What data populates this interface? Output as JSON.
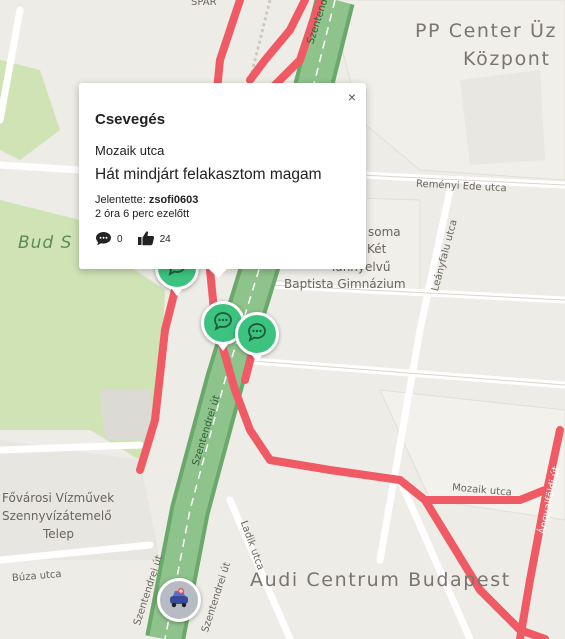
{
  "map": {
    "labels": {
      "spar": "SPAR",
      "pp_center": "PP Center Üz",
      "kozpont": "Központ",
      "remenyi": "Reményi Ede utca",
      "leanyfalu": "Leányfalu utca",
      "school_1": "soma",
      "school_2": "Két",
      "school_3": "Tannyelvű",
      "school_4": "Baptista Gimnázium",
      "bud": "Bud S",
      "vizmuvek_1": "Fővárosi Vízművek",
      "vizmuvek_2": "Szennyvízátemelő",
      "vizmuvek_3": "Telep",
      "buza": "Búza utca",
      "szentendrei_1": "Szentendrei út",
      "szentendrei_2": "Szentendrei út",
      "szentendrei_3": "Szentendrei út",
      "szentendrei_top": "Szentendrei",
      "ladik": "Ladik utca",
      "mozaik": "Mozaik utca",
      "audi": "Audi Centrum Budapest",
      "vertical_right": "Ángyalföldi út"
    },
    "colors": {
      "base": "#eeece6",
      "park": "#cfe3b4",
      "traffic": "#ef5a64",
      "highway": "#7ab47a",
      "marker": "#3cc37f"
    }
  },
  "popup": {
    "title": "Csevegés",
    "close": "×",
    "street": "Mozaik utca",
    "message": "Hát mindjárt felakasztom magam",
    "reported_label": "Jelentette:",
    "reporter": "zsofi0603",
    "time_ago": "2 óra 6 perc ezelőtt",
    "comments_count": "0",
    "likes_count": "24"
  },
  "markers": [
    {
      "icon": "chat-bubble-icon"
    },
    {
      "icon": "chat-bubble-icon"
    },
    {
      "icon": "chat-bubble-icon"
    }
  ],
  "user_marker": {
    "icon": "car-avatar-icon"
  }
}
